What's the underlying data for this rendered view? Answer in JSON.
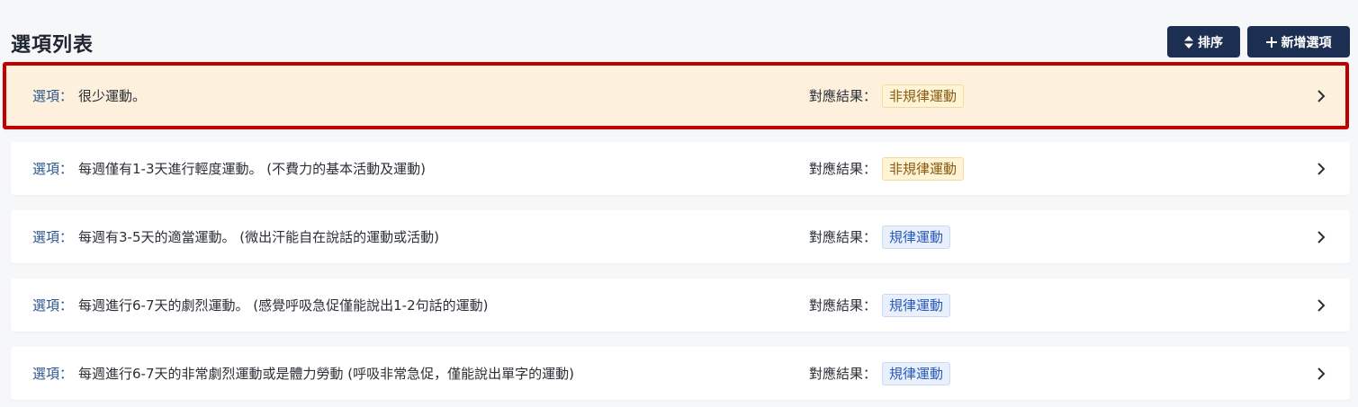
{
  "header": {
    "title": "選項列表",
    "sort_label": "排序",
    "add_label": "新增選項"
  },
  "options": [
    {
      "label": "選項：",
      "text": "很少運動。",
      "result_label": "對應結果：",
      "result": "非規律運動",
      "result_type": "irregular",
      "selected": true
    },
    {
      "label": "選項：",
      "text": "每週僅有1-3天進行輕度運動。 (不費力的基本活動及運動)",
      "result_label": "對應結果：",
      "result": "非規律運動",
      "result_type": "irregular",
      "selected": false
    },
    {
      "label": "選項：",
      "text": "每週有3-5天的適當運動。 (微出汗能自在說話的運動或活動)",
      "result_label": "對應結果：",
      "result": "規律運動",
      "result_type": "regular",
      "selected": false
    },
    {
      "label": "選項：",
      "text": "每週進行6-7天的劇烈運動。 (感覺呼吸急促僅能說出1-2句話的運動)",
      "result_label": "對應結果：",
      "result": "規律運動",
      "result_type": "regular",
      "selected": false
    },
    {
      "label": "選項：",
      "text": "每週進行6-7天的非常劇烈運動或是體力勞動 (呼吸非常急促，僅能說出單字的運動)",
      "result_label": "對應結果：",
      "result": "規律運動",
      "result_type": "regular",
      "selected": false
    }
  ],
  "colors": {
    "primary_button": "#1c2f52",
    "selected_border": "#c00000",
    "selected_background": "#fdf0dc",
    "option_label": "#2c5691"
  },
  "icons": {
    "sort": "sort-icon",
    "add": "plus-icon",
    "row_action": "chevron-right-icon"
  }
}
